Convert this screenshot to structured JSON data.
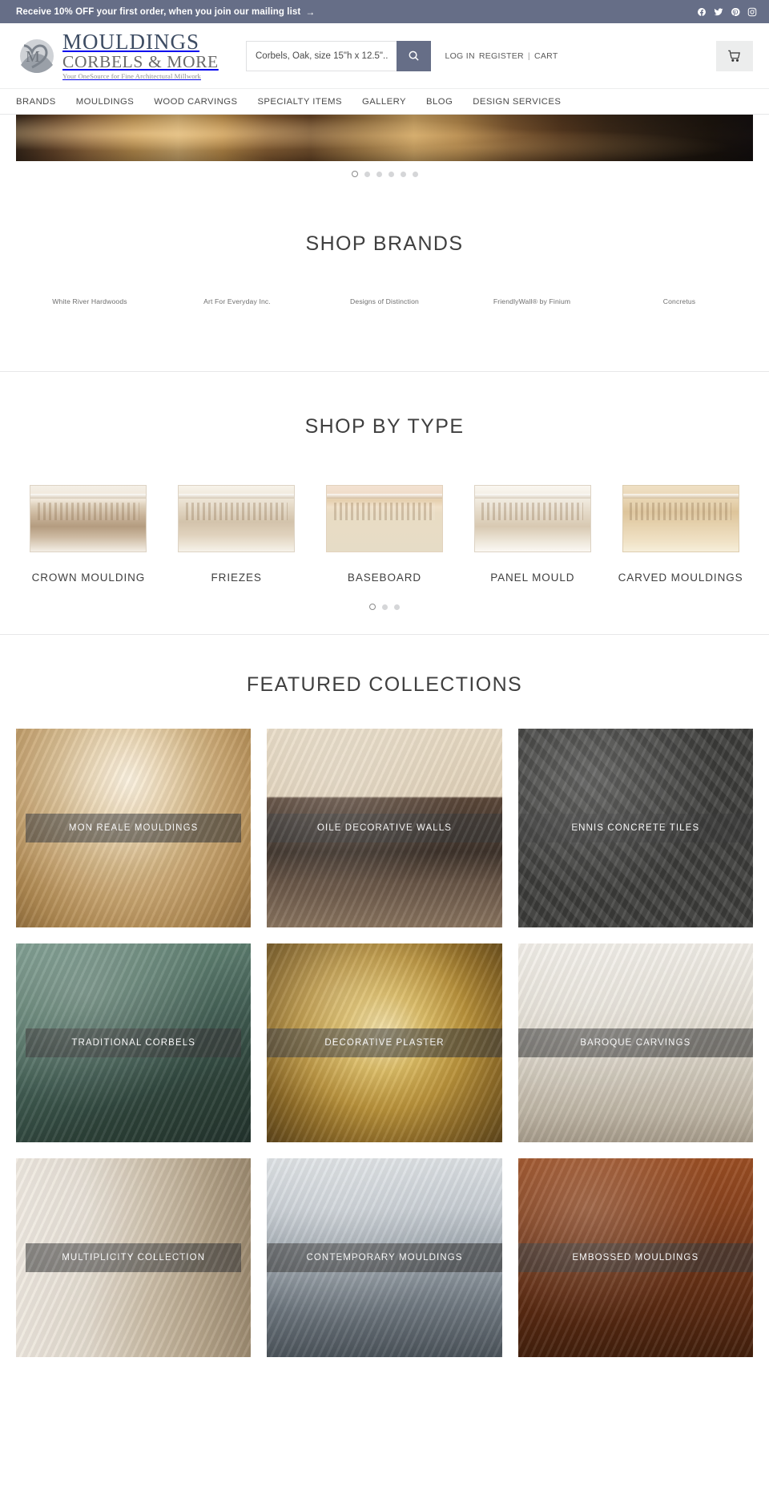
{
  "promo": {
    "text": "Receive 10% OFF your first order, when you join our mailing list",
    "arrow": "→",
    "social": [
      "facebook-icon",
      "twitter-icon",
      "pinterest-icon",
      "instagram-icon"
    ]
  },
  "header": {
    "logo": {
      "line1": "MOULDINGS",
      "line2": "CORBELS & MORE",
      "tagline": "Your OneSource for Fine Architectural Millwork"
    },
    "search": {
      "placeholder": "Corbels, Oak, size 15\"h x 12.5\"...",
      "value": "",
      "button_icon": "search-icon"
    },
    "account": {
      "login": "LOG IN",
      "register": "REGISTER",
      "separator": "|",
      "cart": "CART"
    },
    "cart_icon": "shopping-cart-icon"
  },
  "nav": {
    "items": [
      "BRANDS",
      "MOULDINGS",
      "WOOD CARVINGS",
      "SPECIALTY ITEMS",
      "GALLERY",
      "BLOG",
      "DESIGN SERVICES"
    ]
  },
  "hero": {
    "slide_count": 6,
    "active_slide": 1
  },
  "brands": {
    "title": "SHOP BRANDS",
    "items": [
      "White River Hardwoods",
      "Art For Everyday Inc.",
      "Designs of Distinction",
      "FriendlyWall® by Finium",
      "Concretus"
    ]
  },
  "shop_by_type": {
    "title": "SHOP BY TYPE",
    "items": [
      {
        "label": "CROWN MOULDING",
        "thumb": "crown-moulding-thumb"
      },
      {
        "label": "FRIEZES",
        "thumb": "frieze-moulding-thumb"
      },
      {
        "label": "BASEBOARD",
        "thumb": "baseboard-moulding-thumb"
      },
      {
        "label": "PANEL MOULD",
        "thumb": "panel-moulding-thumb"
      },
      {
        "label": "CARVED MOULDINGS",
        "thumb": "carved-moulding-thumb"
      }
    ],
    "slide_count": 3,
    "active_slide": 1
  },
  "featured": {
    "title": "FEATURED COLLECTIONS",
    "cards": [
      {
        "label": "MON REALE MOULDINGS",
        "image": "ceiling-medallion-photo"
      },
      {
        "label": "OILE DECORATIVE WALLS",
        "image": "living-room-wood-wall-photo"
      },
      {
        "label": "ENNIS CONCRETE TILES",
        "image": "concrete-tile-wall-photo"
      },
      {
        "label": "TRADITIONAL CORBELS",
        "image": "green-kitchen-corbel-photo"
      },
      {
        "label": "DECORATIVE PLASTER",
        "image": "gold-plaster-ornament-photo"
      },
      {
        "label": "BAROQUE CARVINGS",
        "image": "white-kitchen-shelf-photo"
      },
      {
        "label": "MULTIPLICITY COLLECTION",
        "image": "wood-blocks-photo"
      },
      {
        "label": "CONTEMPORARY MOULDINGS",
        "image": "books-moulding-photo"
      },
      {
        "label": "EMBOSSED MOULDINGS",
        "image": "wood-door-arch-photo"
      }
    ]
  },
  "colors": {
    "promo_bar": "#666e87",
    "accent": "#666e87",
    "logo_blue": "#3d4c63",
    "text": "#3f3f3f"
  }
}
